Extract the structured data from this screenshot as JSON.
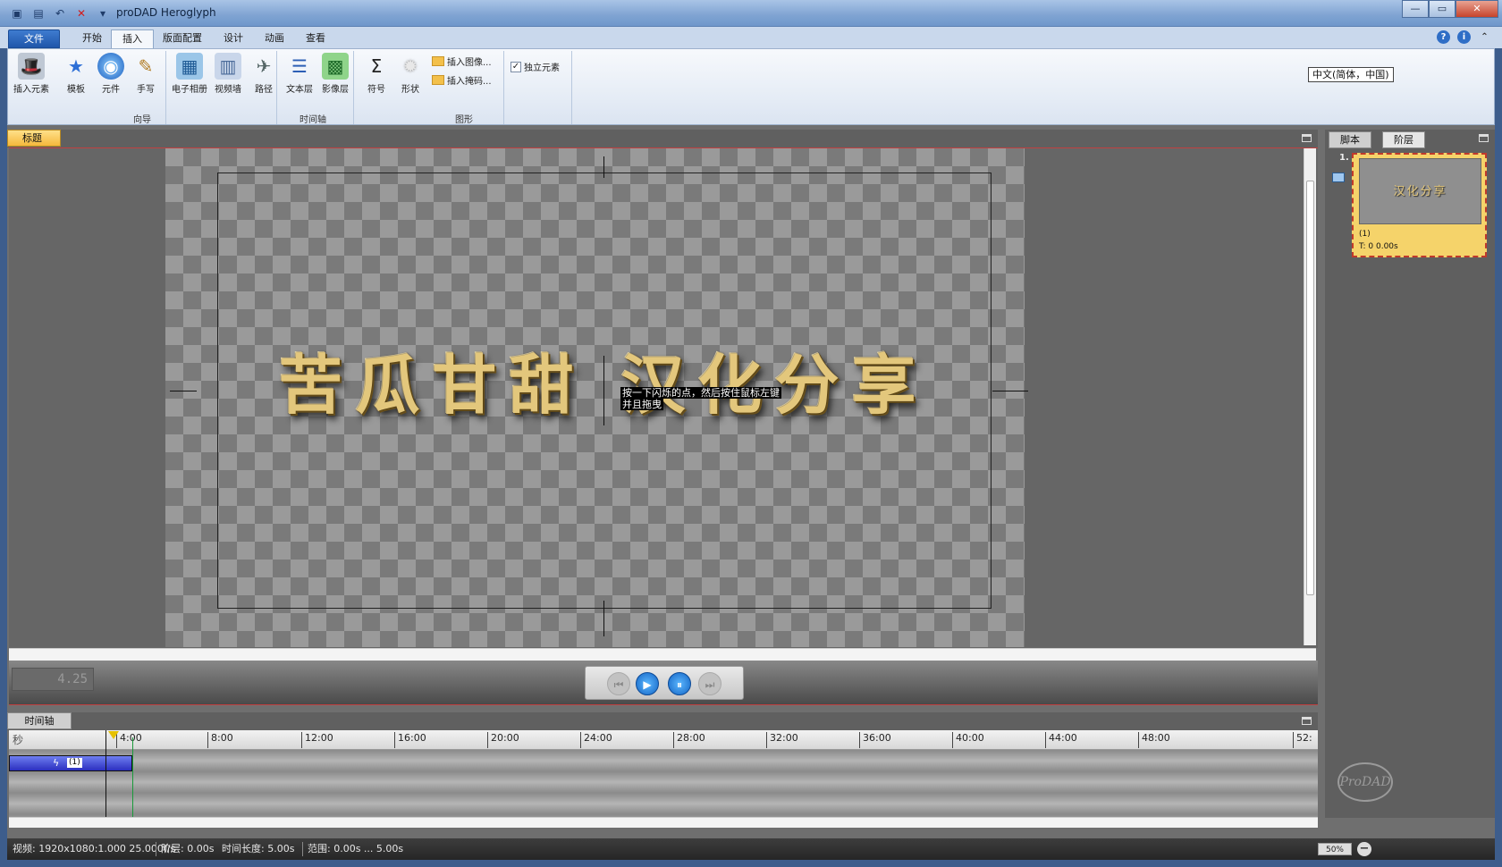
{
  "window": {
    "title": "proDAD Heroglyph",
    "minimize": "—",
    "maximize": "▭",
    "close": "✕"
  },
  "quick_access": [
    "save-icon",
    "open-icon",
    "undo-icon",
    "delete-icon",
    "dropdown-icon"
  ],
  "menu_tabs": [
    "文件",
    "开始",
    "插入",
    "版面配置",
    "设计",
    "动画",
    "查看"
  ],
  "active_tab": "插入",
  "ribbon": {
    "buttons": [
      {
        "label": "插入元素",
        "icon": "wand-icon"
      },
      {
        "label": "模板",
        "icon": "star-icon"
      },
      {
        "label": "元件",
        "icon": "globe-icon"
      },
      {
        "label": "手写",
        "icon": "pen-icon"
      },
      {
        "label": "电子相册",
        "icon": "album-icon"
      },
      {
        "label": "视频墙",
        "icon": "video-wall-icon"
      },
      {
        "label": "路径",
        "icon": "path-icon"
      },
      {
        "label": "文本层",
        "icon": "text-layer-icon"
      },
      {
        "label": "影像层",
        "icon": "image-layer-icon"
      },
      {
        "label": "符号",
        "icon": "sigma-icon"
      },
      {
        "label": "形状",
        "icon": "shape-icon"
      }
    ],
    "groups": [
      "向导",
      "时间轴",
      "图形"
    ],
    "insert_image": "插入图像...",
    "insert_mask": "插入掩码...",
    "independent_element": "独立元素",
    "independent_checked": "✓",
    "language": "中文(简体，中国)"
  },
  "canvas": {
    "tab_label": "标题",
    "title_text": "苦瓜甘甜 汉化分享",
    "hint_line1": "按一下闪烁的点，然后按住鼠标左键",
    "hint_line2": "并且拖曳",
    "time_display": "4.25"
  },
  "right_panel": {
    "tabs": [
      "脚本",
      "阶层"
    ],
    "item_number": "1.",
    "item_thumb_text": "汉化分享",
    "item_name": "(1)",
    "item_time": "T: 0  0.00s",
    "logo": "ProDAD"
  },
  "timeline": {
    "tab_label": "时间轴",
    "unit_label": "秒",
    "ticks": [
      "4:00",
      "8:00",
      "12:00",
      "16:00",
      "20:00",
      "24:00",
      "28:00",
      "32:00",
      "36:00",
      "40:00",
      "44:00",
      "48:00",
      "52:"
    ],
    "clip_label": "(1)"
  },
  "status": {
    "video": "视频: 1920x1080:1.000  25.000f/s",
    "level": "阶层: 0.00s",
    "duration": "时间长度: 5.00s",
    "range": "范围: 0.00s ... 5.00s",
    "zoom": "50%"
  }
}
